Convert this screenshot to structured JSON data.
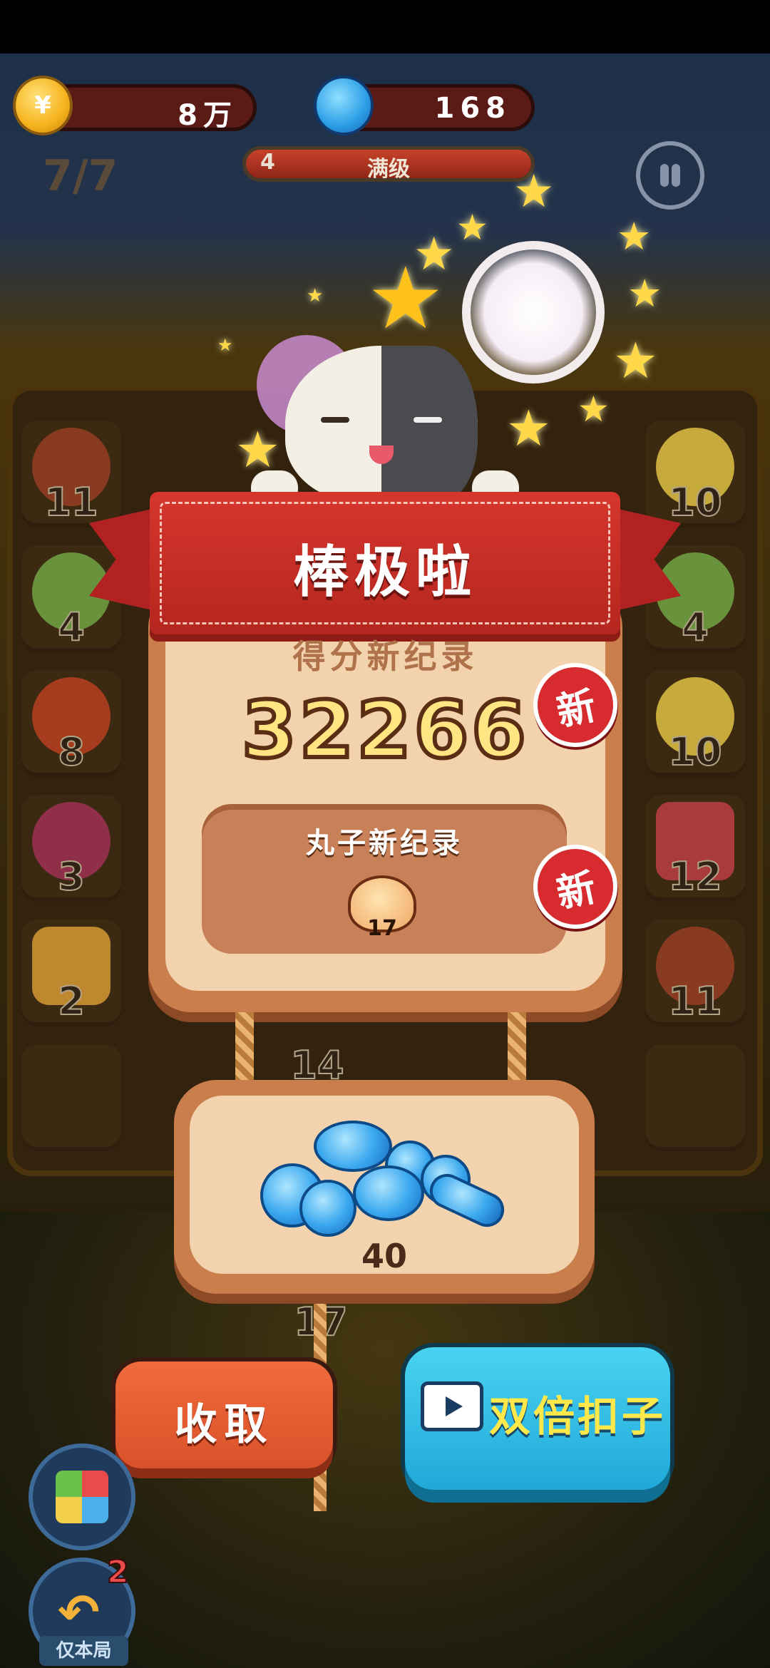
{
  "hud": {
    "coins": {
      "icon": "coin-icon",
      "symbol": "¥",
      "value": "8万"
    },
    "buttons": {
      "icon": "blue-button-icon",
      "value": "168"
    },
    "level": {
      "number": "4",
      "status": "满级",
      "progress": 1.0
    },
    "moves": "7/7"
  },
  "board": {
    "numbers": [
      "11",
      "10",
      "4",
      "4",
      "8",
      "10",
      "3",
      "12",
      "2",
      "11",
      "14",
      "17"
    ]
  },
  "dialog": {
    "title": "棒极啦",
    "score_label": "得分新纪录",
    "score": "32266",
    "new_badge": "新",
    "ball_record_label": "丸子新纪录",
    "ball_record_value": "17",
    "reward_count": "40"
  },
  "actions": {
    "collect": "收取",
    "double": "双倍扣子"
  },
  "tools": {
    "undo_count": "2",
    "undo_label": "仅本局"
  },
  "colors": {
    "ribbon": "#c8302a",
    "panel": "#f3d2ae",
    "score_text": "#ffe682",
    "collect_button": "#e85f33",
    "double_button": "#35bfe6"
  }
}
